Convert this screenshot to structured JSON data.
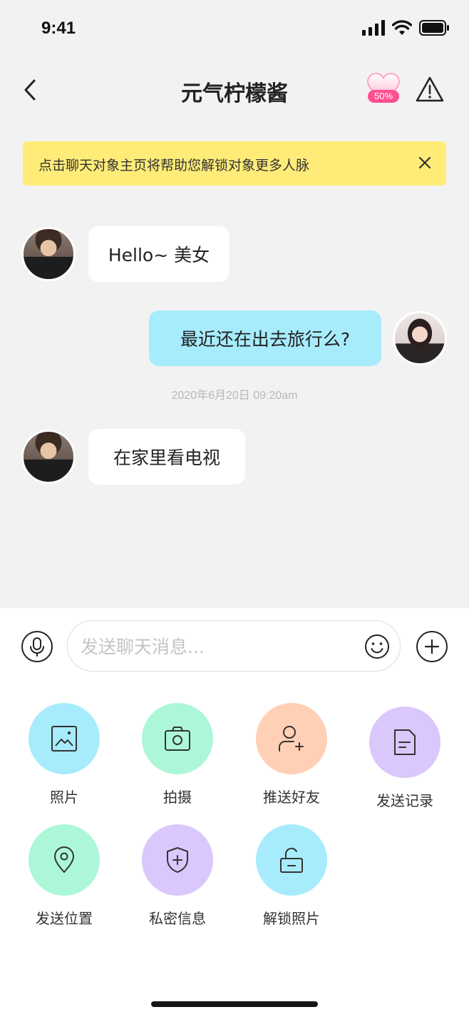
{
  "status_bar": {
    "time": "9:41"
  },
  "header": {
    "title": "元气柠檬酱",
    "intimacy_percent": "50%"
  },
  "notice": {
    "text": "点击聊天对象主页将帮助您解锁对象更多人脉"
  },
  "messages": [
    {
      "side": "in",
      "text": "Hello~ 美女"
    },
    {
      "side": "out",
      "text": "最近还在出去旅行么?"
    },
    {
      "side": "in",
      "text": "在家里看电视"
    }
  ],
  "timestamp": "2020年6月20日 09:20am",
  "composer": {
    "placeholder": "发送聊天消息..."
  },
  "tools": [
    {
      "label": "照片",
      "icon": "photo-icon",
      "color": "#a7ecfd"
    },
    {
      "label": "拍摄",
      "icon": "camera-icon",
      "color": "#adf7d9"
    },
    {
      "label": "推送好友",
      "icon": "add-friend-icon",
      "color": "#ffd0b5"
    },
    {
      "label": "发送记录",
      "icon": "document-icon",
      "color": "#dac7fb"
    },
    {
      "label": "发送位置",
      "icon": "location-icon",
      "color": "#adf7d9"
    },
    {
      "label": "私密信息",
      "icon": "shield-plus-icon",
      "color": "#dac7fb"
    },
    {
      "label": "解锁照片",
      "icon": "unlock-icon",
      "color": "#a7ecfd"
    }
  ]
}
